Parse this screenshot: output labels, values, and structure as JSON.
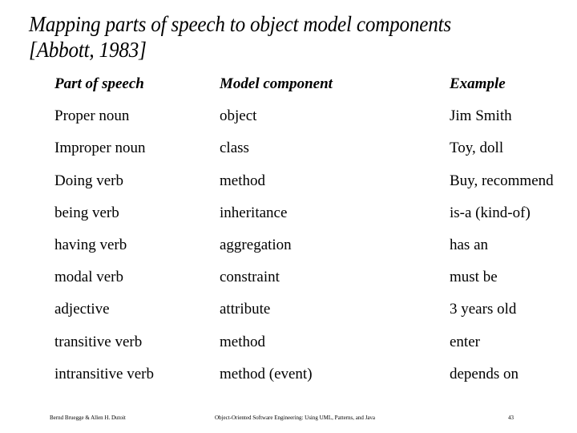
{
  "slide": {
    "title_line1": "Mapping parts of speech to object model components",
    "title_line2": "[Abbott, 1983]"
  },
  "table": {
    "headers": [
      "Part of speech",
      "Model component",
      "Example"
    ],
    "rows": [
      [
        "Proper noun",
        "object",
        "Jim Smith"
      ],
      [
        "Improper noun",
        "class",
        "Toy, doll"
      ],
      [
        "Doing verb",
        "method",
        "Buy, recommend"
      ],
      [
        "being verb",
        "inheritance",
        "is-a (kind-of)"
      ],
      [
        "having verb",
        "aggregation",
        "has an"
      ],
      [
        "modal verb",
        "constraint",
        "must be"
      ],
      [
        "adjective",
        "attribute",
        "3 years old"
      ],
      [
        "transitive verb",
        "method",
        "enter"
      ],
      [
        "intransitive verb",
        "method (event)",
        "depends on"
      ]
    ]
  },
  "footer": {
    "authors": "Bernd Bruegge & Allen H. Dutoit",
    "book": "Object-Oriented Software Engineering: Using UML, Patterns, and Java",
    "page": "43"
  }
}
